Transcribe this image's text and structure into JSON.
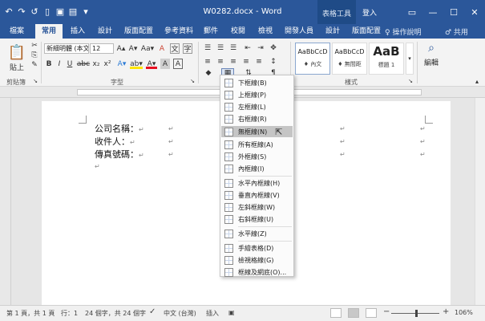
{
  "titlebar": {
    "title": "W0282.docx - Word",
    "context_tab": "表格工具",
    "login": "登入",
    "accent": "#2b579a"
  },
  "qat": {
    "undo_icon": "↶",
    "redo_icon": "↷",
    "repeat_icon": "↺",
    "new_icon": "▯",
    "save_icon": "▣",
    "print_icon": "▤",
    "more_icon": "▾"
  },
  "window_buttons": {
    "restore": "▭",
    "minimize": "—",
    "maximize": "☐",
    "close": "✕"
  },
  "tabs": [
    {
      "label": "檔案"
    },
    {
      "label": "常用"
    },
    {
      "label": "插入"
    },
    {
      "label": "設計"
    },
    {
      "label": "版面配置"
    },
    {
      "label": "參考資料"
    },
    {
      "label": "郵件"
    },
    {
      "label": "校閱"
    },
    {
      "label": "檢視"
    },
    {
      "label": "開發人員"
    },
    {
      "label": "設計"
    },
    {
      "label": "版面配置"
    }
  ],
  "tell_me": "♀ 操作說明",
  "share": "♂ 共用",
  "ribbon": {
    "paste_label": "貼上",
    "font_name": "新細明體 (本文)",
    "font_size": "12",
    "font_grow": "A▴",
    "font_shrink": "A▾",
    "change_case": "Aa▾",
    "clear_format": "A",
    "bold": "B",
    "italic": "I",
    "underline": "U",
    "strike": "abc",
    "subscript": "x₂",
    "superscript": "x²",
    "text_effect": "A▾",
    "highlight": "ab▾",
    "font_color": "A▾",
    "char_shade": "A",
    "char_border": "A",
    "groups": {
      "clipboard": "剪貼簿",
      "font": "字型",
      "styles": "樣式"
    },
    "styles": [
      {
        "sample": "AaBbCcD",
        "name": "♦ 內文"
      },
      {
        "sample": "AaBbCcD",
        "name": "♦ 無間距"
      },
      {
        "sample": "AaB",
        "name": "標題 1"
      }
    ],
    "edit_label": "編輯",
    "search_icon": "⌕",
    "expand_icon": "▴"
  },
  "document": {
    "lines": [
      "公司名稱：",
      "收件人：",
      "傳真號碼："
    ],
    "para_mark": "↵"
  },
  "border_menu": {
    "items": [
      {
        "label": "下框線(B)",
        "icon": "border-bottom-icon"
      },
      {
        "label": "上框線(P)",
        "icon": "border-top-icon"
      },
      {
        "label": "左框線(L)",
        "icon": "border-left-icon"
      },
      {
        "label": "右框線(R)",
        "icon": "border-right-icon"
      },
      {
        "label": "無框線(N)",
        "icon": "no-border-icon"
      },
      {
        "label": "所有框線(A)",
        "icon": "all-borders-icon"
      },
      {
        "label": "外框線(S)",
        "icon": "outside-borders-icon"
      },
      {
        "label": "內框線(I)",
        "icon": "inside-borders-icon"
      },
      {
        "label": "水平內框線(H)",
        "icon": "inside-horizontal-icon"
      },
      {
        "label": "垂直內框線(V)",
        "icon": "inside-vertical-icon"
      },
      {
        "label": "左斜框線(W)",
        "icon": "diagonal-down-icon"
      },
      {
        "label": "右斜框線(U)",
        "icon": "diagonal-up-icon"
      },
      {
        "label": "水平線(Z)",
        "icon": "horizontal-line-icon"
      },
      {
        "label": "手繪表格(D)",
        "icon": "draw-table-icon"
      },
      {
        "label": "檢視格線(G)",
        "icon": "view-gridlines-icon"
      },
      {
        "label": "框線及網底(O)...",
        "icon": "borders-shading-icon"
      }
    ],
    "highlighted": "無框線(N)"
  },
  "statusbar": {
    "page": "第 1 頁，共 1 頁",
    "line": "行：1",
    "words": "24 個字，共 24 個字",
    "language": "中文 (台灣)",
    "mode": "插入",
    "zoom_minus": "−",
    "zoom_plus": "+",
    "zoom": "106%"
  }
}
